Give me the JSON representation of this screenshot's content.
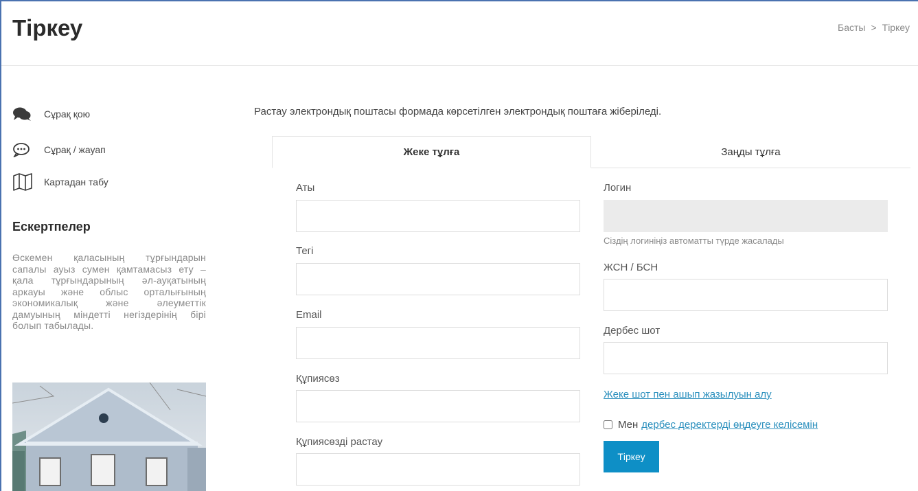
{
  "header": {
    "title": "Тіркеу",
    "breadcrumb": {
      "home": "Басты",
      "separator": ">",
      "current": "Тіркеу"
    }
  },
  "sidebar": {
    "items": [
      {
        "label": "Сұрақ қою",
        "icon": "chat-bubbles-icon"
      },
      {
        "label": "Сұрақ / жауап",
        "icon": "speech-bubble-icon"
      },
      {
        "label": "Картадан табу",
        "icon": "map-icon"
      }
    ],
    "notes_title": "Ескертпелер",
    "notes_text": "Өскемен қаласының тұрғындарын сапалы ауыз сумен қамтамасыз ету – қала тұрғындарының әл-ауқатының аркауы және облыс орталығының экономикалық және әлеуметтік дамуының міндетті негіздерінің бірі болып табылады."
  },
  "main": {
    "intro": "Растау электрондық поштасы формада көрсетілген электрондық поштаға жіберіледі.",
    "tabs": [
      {
        "label": "Жеке тұлға",
        "active": true
      },
      {
        "label": "Заңды тұлға",
        "active": false
      }
    ],
    "left_fields": [
      {
        "label": "Аты",
        "value": ""
      },
      {
        "label": "Тегі",
        "value": ""
      },
      {
        "label": "Email",
        "value": ""
      },
      {
        "label": "Құпиясөз",
        "value": ""
      },
      {
        "label": "Құпиясөзді растау",
        "value": ""
      }
    ],
    "login": {
      "label": "Логин",
      "value": "",
      "help": "Сіздің логиніңіз автоматты түрде жасалады"
    },
    "iin": {
      "label": "ЖСН / БСН",
      "value": ""
    },
    "account": {
      "label": "Дербес шот",
      "value": ""
    },
    "account_link": "Жеке шот пен ашып жазылуын алу",
    "agree": {
      "prefix": "Мен",
      "link": "дербес деректерді өңдеуге келісемін",
      "checked": false
    },
    "submit_label": "Тіркеу"
  },
  "colors": {
    "accent": "#0e8fc6",
    "link": "#2a8fbd",
    "frame": "#4a72b0"
  }
}
